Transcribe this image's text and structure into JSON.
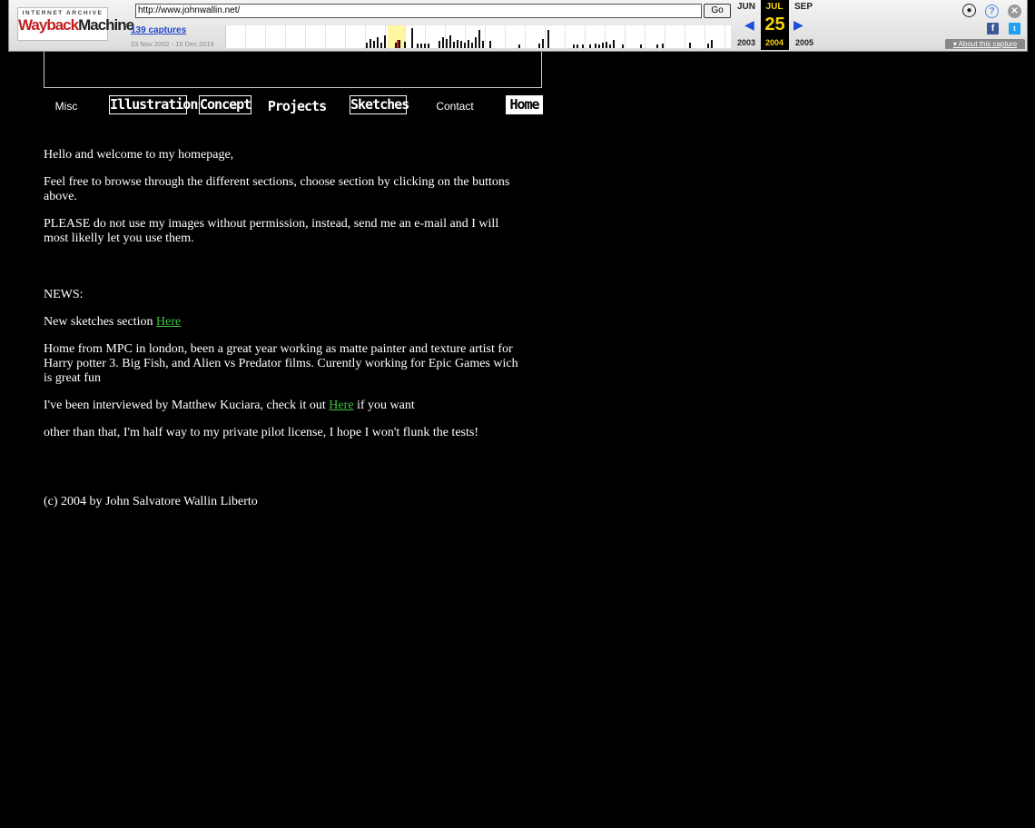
{
  "wayback": {
    "logo_top": "INTERNET ARCHIVE",
    "logo_word_a": "Wayback",
    "logo_word_b": "Machine",
    "url": "http://www.johnwallin.net/",
    "go_label": "Go",
    "captures": "139 captures",
    "range": "23 Nov 2002 - 15 Dec 2019",
    "prev_month": "JUN",
    "cur_month": "JUL",
    "next_month": "SEP",
    "cur_day": "25",
    "prev_year": "2003",
    "cur_year": "2004",
    "next_year": "2005",
    "about": "About this capture",
    "icons": [
      "user-icon",
      "help-icon",
      "close-icon",
      "facebook-icon",
      "twitter-icon",
      "prev-arrow-icon",
      "next-arrow-icon"
    ]
  },
  "nav": {
    "misc": "Misc",
    "illustrations": "Illustrations",
    "concept": "Concept",
    "projects": "Projects",
    "sketches": "Sketches",
    "contact": "Contact",
    "home": "Home"
  },
  "content": {
    "p1": "Hello and welcome to my homepage,",
    "p2": "Feel free to browse through the different sections, choose section by clicking on the buttons above.",
    "p3": "PLEASE do not use my images without permission, instead, send me an e-mail and I will most likelly let you use them.",
    "news_heading": "NEWS:",
    "news1_text": "New sketches section ",
    "news1_link": "Here",
    "news2": "Home from MPC in london, been a great year working as matte painter and texture artist for Harry potter 3. Big Fish, and Alien vs Predator films. Curently working for Epic Games wich is great fun",
    "news3_text": "I've been interviewed by Matthew Kuciara, check it out ",
    "news3_link": "Here",
    "news3_tail": " if you want",
    "news4": "other than that, I'm half way to my private pilot license, I hope I won't flunk the tests!",
    "copyright": "(c) 2004 by John Salvatore Wallin Liberto"
  },
  "colors": {
    "background": "#000000",
    "text": "#ffffff",
    "link": "#3ec23e",
    "wayback_highlight": "#f5d40e"
  }
}
